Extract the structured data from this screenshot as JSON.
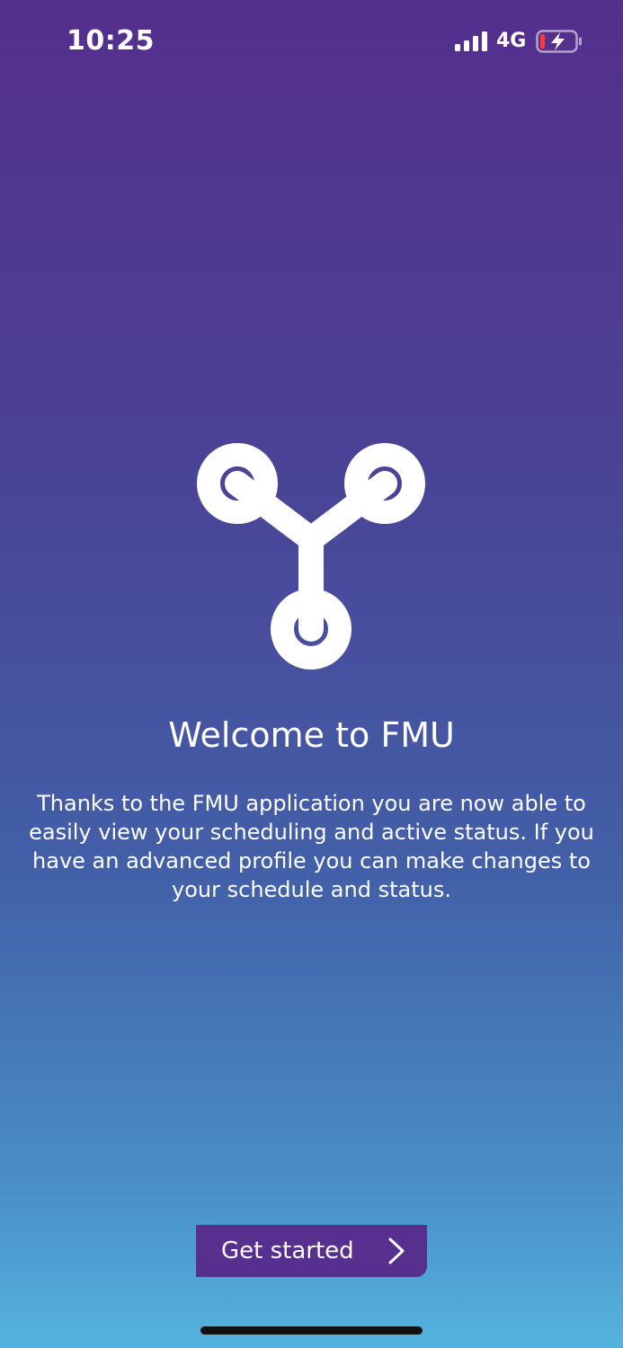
{
  "status_bar": {
    "time": "10:25",
    "network": "4G",
    "signal_icon": "cellular-signal-icon",
    "battery_icon": "battery-charging-low-icon"
  },
  "logo": {
    "icon": "fmu-network-logo-icon"
  },
  "welcome": {
    "title": "Welcome to FMU",
    "description": "Thanks to the FMU application you are now able to easily view your scheduling and active status. If you have an advanced profile you can make changes to your schedule and status."
  },
  "cta": {
    "label": "Get started",
    "icon": "chevron-right-icon"
  },
  "colors": {
    "gradient_top": "#552f8d",
    "gradient_bottom": "#55b3df",
    "button_bg": "#57308f",
    "battery_low": "#ff3b30"
  }
}
